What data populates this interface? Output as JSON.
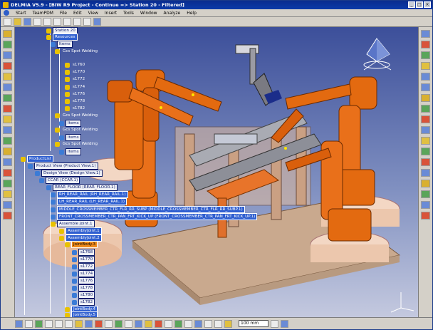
{
  "window": {
    "title": "DELMIA V5.9 - [BIW R9 Project - Continue => Station 20 - Filtered]",
    "buttons": [
      "_",
      "□",
      "×"
    ]
  },
  "menu": [
    "Start",
    "TeamPDM",
    "File",
    "Edit",
    "View",
    "Insert",
    "Tools",
    "Window",
    "Analyze",
    "Help"
  ],
  "tree": {
    "station": "Station 20",
    "resources": "Resources",
    "items": [
      {
        "label": "Items",
        "style": "boxed"
      },
      {
        "label": "Gcs Spot Welding",
        "style": "plain"
      },
      {
        "label": "s1760",
        "style": "plain"
      },
      {
        "label": "s1770",
        "style": "plain"
      },
      {
        "label": "s1772",
        "style": "plain"
      },
      {
        "label": "s1774",
        "style": "plain"
      },
      {
        "label": "s1776",
        "style": "plain"
      },
      {
        "label": "s1778",
        "style": "plain"
      },
      {
        "label": "s1782",
        "style": "plain"
      },
      {
        "label": "Gcs Spot Welding",
        "style": "plain"
      },
      {
        "label": "Items",
        "style": "boxed"
      },
      {
        "label": "Gcs Spot Welding",
        "style": "plain"
      },
      {
        "label": "Items",
        "style": "boxed"
      },
      {
        "label": "Gcs Spot Welding",
        "style": "plain"
      },
      {
        "label": "Items",
        "style": "boxed"
      }
    ],
    "product": [
      {
        "label": "ProductList",
        "style": "hl"
      },
      {
        "label": "Product View (Product View.1)",
        "style": "boxed"
      },
      {
        "label": "Design View (Design View.1)",
        "style": "boxed"
      },
      {
        "label": "CCAR (CCAR.1)",
        "style": "boxed"
      },
      {
        "label": "REAR_FLOOR (REAR_FLOOR.1)",
        "style": "boxed"
      },
      {
        "label": "RH_REAR_RAIL (RH_REAR_RAIL.1)",
        "style": "hl"
      },
      {
        "label": "LH_REAR_RAIL (LH_REAR_RAIL.1)",
        "style": "hl"
      },
      {
        "label": "MIDDLE_CROSSMEMBER_CTR_FLR_RR_SUBP (MIDDLE_CROSSMEMBER_CTR_FLR_RR_SUBP.1)",
        "style": "hl"
      },
      {
        "label": "FRONT_CROSSMEMBER_CTR_PAN_FRT_KICK_UP (FRONT_CROSSMEMBER_CTR_PAN_FRT_KICK_UP.1)",
        "style": "hl"
      },
      {
        "label": "Assemble Joint.1",
        "style": "boxed"
      },
      {
        "label": "AssemblyJoint.1",
        "style": "hl"
      },
      {
        "label": "AssemblyJoint.2",
        "style": "hl"
      },
      {
        "label": "JointBody.3",
        "style": "orange"
      },
      {
        "label": "s1768",
        "style": "boxed"
      },
      {
        "label": "s1770",
        "style": "boxed"
      },
      {
        "label": "s1772",
        "style": "boxed"
      },
      {
        "label": "s1774",
        "style": "boxed"
      },
      {
        "label": "s1776",
        "style": "boxed"
      },
      {
        "label": "s1778",
        "style": "boxed"
      },
      {
        "label": "s1780",
        "style": "boxed"
      },
      {
        "label": "s1782",
        "style": "boxed"
      },
      {
        "label": "JointBody.4",
        "style": "hl"
      },
      {
        "label": "JointBody.5",
        "style": "hl"
      }
    ]
  },
  "bottombar": {
    "select_value": "100 mm"
  },
  "colors": {
    "robot": "#e36a10",
    "fixture": "#c9a98e",
    "tree_highlight": "#2f5fd0",
    "selected": "#f08a1a"
  }
}
